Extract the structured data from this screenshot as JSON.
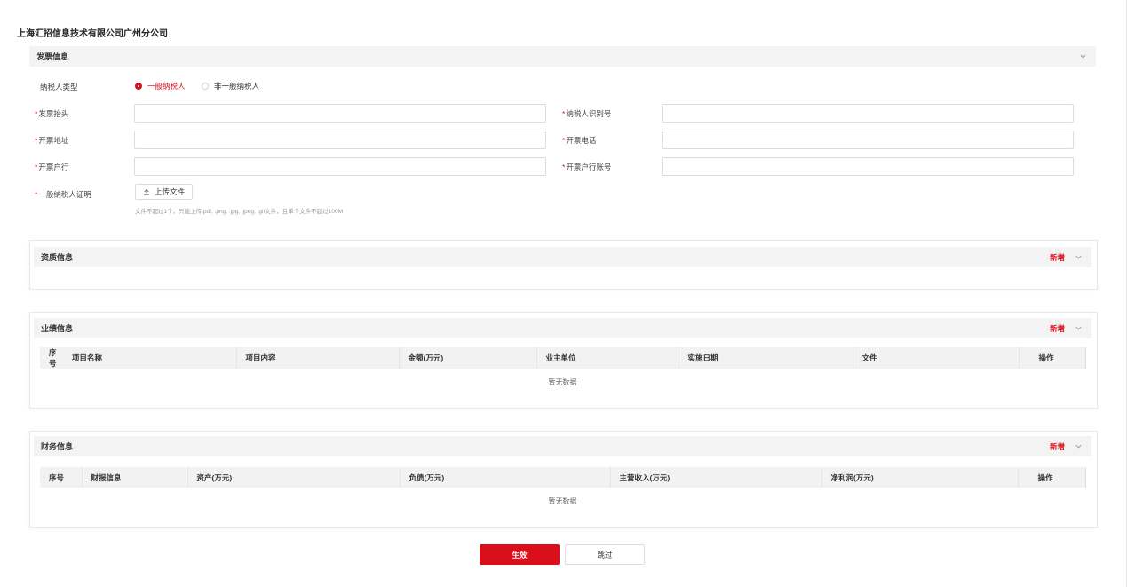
{
  "company_name": "上海汇招信息技术有限公司广州分公司",
  "invoice": {
    "title": "发票信息",
    "taxpayer_type_label": "纳税人类型",
    "taxpayer_options": [
      "一般纳税人",
      "非一般纳税人"
    ],
    "selected_option": "一般纳税人",
    "fields": {
      "invoice_header": "发票抬头",
      "taxpayer_id": "纳税人识别号",
      "address": "开票地址",
      "phone": "开票电话",
      "bank": "开票户行",
      "bank_account": "开票户行账号",
      "certificate": "一般纳税人证明"
    },
    "upload_label": "上传文件",
    "upload_hint": "文件不超过1个，只能上传.pdf, .png, .jpg, .jpeg, .gif文件，且单个文件不超过100M"
  },
  "qualification": {
    "title": "资质信息",
    "add_label": "新增"
  },
  "performance": {
    "title": "业绩信息",
    "add_label": "新增",
    "columns": [
      "序号",
      "项目名称",
      "项目内容",
      "金额(万元)",
      "业主单位",
      "实施日期",
      "文件",
      "操作"
    ],
    "empty_text": "暂无数据"
  },
  "finance": {
    "title": "财务信息",
    "add_label": "新增",
    "columns": [
      "序号",
      "财报信息",
      "资产(万元)",
      "负债(万元)",
      "主营收入(万元)",
      "净利润(万元)",
      "操作"
    ],
    "empty_text": "暂无数据"
  },
  "actions": {
    "submit_label": "生效",
    "skip_label": "跳过"
  },
  "colors": {
    "accent": "#d9101c",
    "header_bg": "#f3f3f3"
  }
}
